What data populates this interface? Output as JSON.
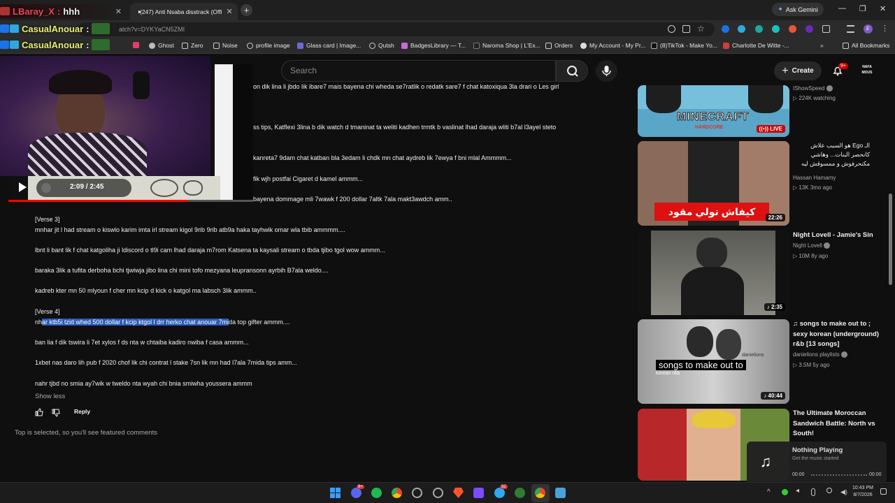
{
  "tabs": [
    {
      "label": "",
      "close": "✕"
    },
    {
      "label": "(247) Anti Nsaba disstrack (Offi",
      "close": "✕"
    }
  ],
  "new_tab": "+",
  "gemini_label": "Ask Gemini",
  "window_controls": {
    "minimize": "—",
    "restore": "❐",
    "close": "✕"
  },
  "address": {
    "url": "atch?v=DYKYaCN5ZMI"
  },
  "bookmarks": [
    {
      "label": "Ghost",
      "icon": "ghost-icon"
    },
    {
      "label": "Zero",
      "icon": "folder-icon"
    },
    {
      "label": "Noise",
      "icon": "folder-icon"
    },
    {
      "label": "profile image",
      "icon": "globe-icon"
    },
    {
      "label": "Glass card | Image...",
      "icon": "site-icon"
    },
    {
      "label": "Qutsh",
      "icon": "globe-icon"
    },
    {
      "label": "BadgesLibrary — T...",
      "icon": "site-icon"
    },
    {
      "label": "Naroma Shop | L'Ex...",
      "icon": "site-icon"
    },
    {
      "label": "Orders",
      "icon": "folder-icon"
    },
    {
      "label": "My Account - My Pr...",
      "icon": "site-icon"
    },
    {
      "label": "(8)TikTok - Make Yo...",
      "icon": "tiktok-icon"
    },
    {
      "label": "Charlotte De Witte -...",
      "icon": "site-icon"
    },
    {
      "label": "All Bookmarks",
      "icon": "folder-icon"
    }
  ],
  "overlay": {
    "chat": [
      {
        "user": "LBaray_X",
        "message": "hhh"
      },
      {
        "user": "CasualAnouar",
        "message": ":"
      },
      {
        "user": "CasualAnouar",
        "message": ":"
      }
    ],
    "player": {
      "current": "2:09",
      "sep": "/",
      "total": "2:45"
    }
  },
  "header": {
    "search_placeholder": "Search",
    "create_label": "Create",
    "notif_count": "9+",
    "avatar_text": "NAFA MOUS"
  },
  "comment": {
    "top_lines": [
      "on dik lina li jbdo lik ibare7 mais bayena chi wheda se7ratlik o redatk sare7 f chat katoxiqua 3la drari o Les girl",
      "ss tips,  Katflexi 3lina b dik watch d tmaninat ta weliti kadhen trmtk b vaslinat lhad daraja wliti b7al l3ayel steto",
      "kanreta7 9dam chat katban bla 3edam li chdk mn chat aydreb lik 7ewya f bni mlal Ammmm...",
      "fik wjh postfai Cigaret d kamel ammm...",
      "bayena dommage mli 7wawk f 200 dollar 7altk 7ala makt3awdch amm.."
    ],
    "verse3_label": "[Verse 3]",
    "verse3": [
      "mnhar jit l had stream o kiswlo karim imta irl stream kigol 9rib 9rib atb9a haka tayhwik omar wla tbib ammmm....",
      "lbnt li bant lik f chat katgoliha ji ldiscord o tl9i cam lhad daraja m7rom Katsena ta kaysali stream o tbda tjibo tgol wow ammm...",
      "baraka 3lik a tufita derboha bchi tjwiwja jibo lina chi mini tofo mezyana leupransonn ayrbih B7ala weldo....",
      "kadreb kter mn 50 mlyoun f cher mn kcip d kick o katgol ma labsch 3lik ammm.."
    ],
    "verse4_label": "[Verse 4]",
    "verse4_first": {
      "pre": "nh",
      "highlight": "ar ktb5i tzid whed 500 dollar f kcip ktgol l drr herko chat anouar 7mi",
      "post": "da top gifter ammm...."
    },
    "verse4": [
      "ban lia f dik tswira li 7et xylos f ds nta w chtaiba kadiro nwiba f casa ammm...",
      "1xbet nas daro lih pub f 2020 chof lik chi contrat l stake 7sn lik mn had l7ala 7mida tips amm...",
      "nahr tjbd no smia ay7wik w tweldo nta wyah chi bnia smiwha youssera ammm"
    ],
    "show_less": "Show less",
    "reply": "Reply",
    "featured_note": "Top is selected, so you'll see featured comments"
  },
  "sidebar": [
    {
      "title": "",
      "channel": "IShowSpeed",
      "meta": "224K watching",
      "badge": "LIVE",
      "thumb_text": "MINECRAFT",
      "thumb_sub": "HARDCORE"
    },
    {
      "title": "الـ Ego هو السبب علاش كانحصر البنات... وهاشي مكنحرفوش و ممسوقش ليه",
      "channel": "Hassan Hamamy",
      "meta": "13K  3mo ago",
      "duration": "22:26",
      "thumb_text": "كيفاش تولي مقود"
    },
    {
      "title": "Night Lovell - Jamie's Sin",
      "channel": "Night Lovell",
      "meta": "10M  8y ago",
      "duration": "2:35"
    },
    {
      "title": "♫ songs to make out to ; sexy korean (underground) r&b [13 songs]",
      "channel": "danielions playlists",
      "meta": "3.5M  5y ago",
      "duration": "40:44",
      "thumb_text": "songs to make out to",
      "thumb_sub": "korean r&b",
      "thumb_tag": "danielions"
    },
    {
      "title": "The Ultimate Moroccan Sandwich Battle: North vs South!",
      "channel": "",
      "meta": ""
    }
  ],
  "media_widget": {
    "title": "Nothing Playing",
    "subtitle": "Get the music started",
    "start": "00:00",
    "end": "00:00"
  },
  "system": {
    "time": "10:43 PM",
    "date": "8/7/2026",
    "discord_badge": "9+",
    "telegram_badge": "32"
  },
  "colors": {
    "youtube_red": "#ff0000",
    "highlight": "#2b5cb8",
    "background": "#0f0f0f"
  }
}
